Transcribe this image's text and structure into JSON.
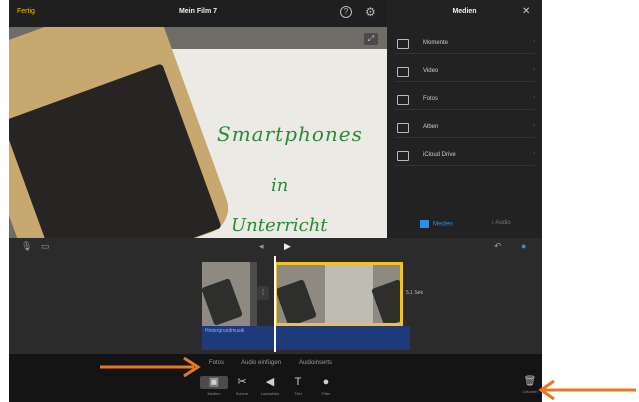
{
  "topbar": {
    "done_label": "Fertig",
    "title": "Mein Film 7",
    "help_icon": "?",
    "settings_icon": "⚙"
  },
  "preview": {
    "handwriting_line1": "Smartphones",
    "handwriting_line2": "in",
    "handwriting_line3": "Unterricht"
  },
  "media": {
    "header": "Medien",
    "close_icon": "✕",
    "items": [
      {
        "label": "Momente",
        "icon": "moments-icon"
      },
      {
        "label": "Video",
        "icon": "video-icon"
      },
      {
        "label": "Fotos",
        "icon": "photos-icon"
      },
      {
        "label": "Alben",
        "icon": "albums-icon"
      },
      {
        "label": "iCloud Drive",
        "icon": "icloud-icon"
      }
    ],
    "tabs": {
      "media": "Medien",
      "audio": "Audio"
    }
  },
  "timeline": {
    "clip_duration": "5,1 Sek",
    "audio_label": "Hintergrundmusik"
  },
  "bottombar": {
    "tabs": [
      "Fotos",
      "Audio einfügen",
      "Audioinserts"
    ],
    "tools": [
      {
        "label": "Medien",
        "icon": "media-icon",
        "active": true
      },
      {
        "label": "Schere",
        "icon": "scissors-icon"
      },
      {
        "label": "Lautstärke",
        "icon": "volume-icon"
      },
      {
        "label": "Titel",
        "icon": "text-icon"
      },
      {
        "label": "Filter",
        "icon": "filter-icon"
      }
    ],
    "trash_label": "Löschen"
  },
  "colors": {
    "accent_yellow": "#f2c12e",
    "accent_blue": "#2f8fe8",
    "annotation_orange": "#e87722"
  }
}
